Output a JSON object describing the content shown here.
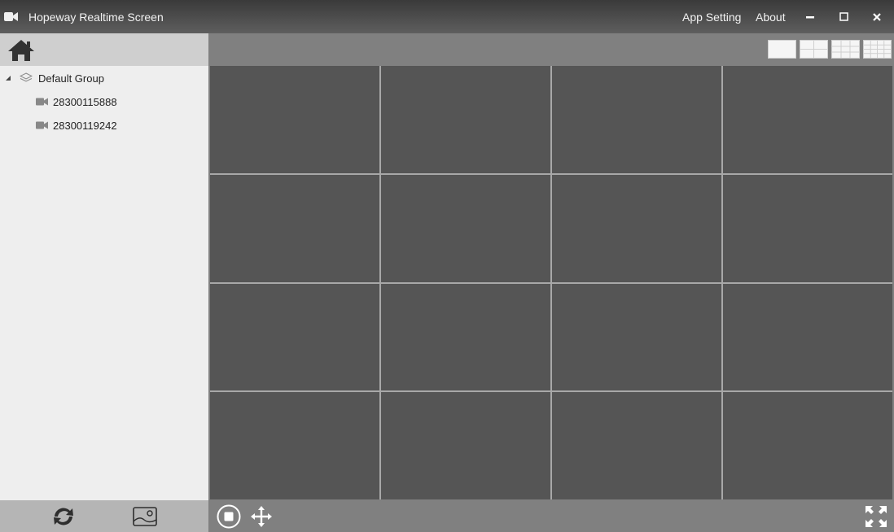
{
  "titlebar": {
    "app_icon": "video-camera-icon",
    "title": "Hopeway Realtime Screen",
    "menu": [
      "App Setting",
      "About"
    ],
    "controls": [
      "minimize-icon",
      "maximize-icon",
      "close-icon"
    ]
  },
  "sidebar": {
    "home_icon": "home-icon",
    "tree": {
      "group": {
        "label": "Default Group",
        "icon": "layers-icon",
        "expanded": true
      },
      "devices": [
        {
          "label": "28300115888",
          "icon": "video-camera-icon"
        },
        {
          "label": "28300119242",
          "icon": "video-camera-icon"
        }
      ]
    },
    "footer": [
      "refresh-icon",
      "image-icon"
    ]
  },
  "main": {
    "layouts": [
      "layout-1x1",
      "layout-2x2",
      "layout-3x3",
      "layout-4x4"
    ],
    "grid": {
      "rows": 4,
      "cols": 4
    },
    "bottom_left": [
      "stop-icon",
      "move-icon"
    ],
    "bottom_right": "fullscreen-icon"
  },
  "colors": {
    "titlebar": "#4a4a4a",
    "sidebar": "#eeeeee",
    "sidebar_header": "#cfcfcf",
    "sidebar_footer": "#b5b5b5",
    "main_bg": "#808080",
    "cell": "#555555",
    "cell_border": "#a8a8a8"
  }
}
